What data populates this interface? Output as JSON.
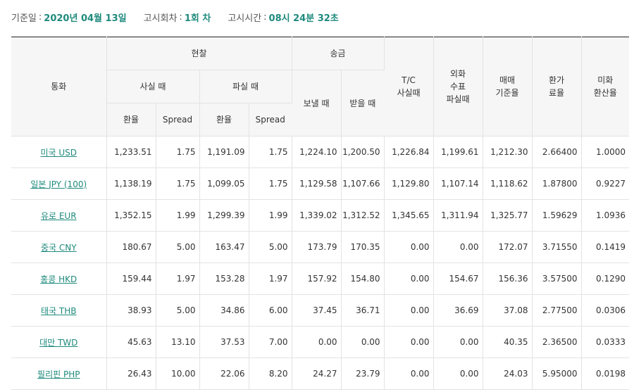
{
  "info": {
    "date_label": "기준일",
    "date_value": "2020년 04월 13일",
    "round_label": "고시회차",
    "round_value": "1회 차",
    "time_label": "고시시간",
    "time_value": "08시 24분 32초"
  },
  "table": {
    "headers": {
      "currency": "통화",
      "cash": "현찰",
      "cash_buy": "사실 때",
      "cash_sell": "파실 때",
      "rate": "환율",
      "spread": "Spread",
      "remit": "송금",
      "remit_send": "보낼 때",
      "remit_receive": "받을 때",
      "tc_buy": [
        "T/C",
        "사실때"
      ],
      "foreign_check_sell": [
        "외화",
        "수표",
        "파실때"
      ],
      "base_rate": [
        "매매",
        "기준율"
      ],
      "conversion_rate": [
        "환가",
        "료율"
      ],
      "usd_conversion": [
        "미화",
        "환산율"
      ]
    },
    "rows": [
      {
        "currency": "미국 USD",
        "cash_buy_rate": "1,233.51",
        "cash_buy_spread": "1.75",
        "cash_sell_rate": "1,191.09",
        "cash_sell_spread": "1.75",
        "send": "1,224.10",
        "receive": "1,200.50",
        "tc_buy": "1,226.84",
        "check_sell": "1,199.61",
        "base_rate": "1,212.30",
        "conversion_rate": "2.66400",
        "usd_conversion": "1.0000"
      },
      {
        "currency": "일본 JPY (100)",
        "cash_buy_rate": "1,138.19",
        "cash_buy_spread": "1.75",
        "cash_sell_rate": "1,099.05",
        "cash_sell_spread": "1.75",
        "send": "1,129.58",
        "receive": "1,107.66",
        "tc_buy": "1,129.80",
        "check_sell": "1,107.14",
        "base_rate": "1,118.62",
        "conversion_rate": "1.87800",
        "usd_conversion": "0.9227"
      },
      {
        "currency": "유로 EUR",
        "cash_buy_rate": "1,352.15",
        "cash_buy_spread": "1.99",
        "cash_sell_rate": "1,299.39",
        "cash_sell_spread": "1.99",
        "send": "1,339.02",
        "receive": "1,312.52",
        "tc_buy": "1,345.65",
        "check_sell": "1,311.94",
        "base_rate": "1,325.77",
        "conversion_rate": "1.59629",
        "usd_conversion": "1.0936"
      },
      {
        "currency": "중국 CNY",
        "cash_buy_rate": "180.67",
        "cash_buy_spread": "5.00",
        "cash_sell_rate": "163.47",
        "cash_sell_spread": "5.00",
        "send": "173.79",
        "receive": "170.35",
        "tc_buy": "0.00",
        "check_sell": "0.00",
        "base_rate": "172.07",
        "conversion_rate": "3.71550",
        "usd_conversion": "0.1419"
      },
      {
        "currency": "홍콩 HKD",
        "cash_buy_rate": "159.44",
        "cash_buy_spread": "1.97",
        "cash_sell_rate": "153.28",
        "cash_sell_spread": "1.97",
        "send": "157.92",
        "receive": "154.80",
        "tc_buy": "0.00",
        "check_sell": "154.67",
        "base_rate": "156.36",
        "conversion_rate": "3.57500",
        "usd_conversion": "0.1290"
      },
      {
        "currency": "태국 THB",
        "cash_buy_rate": "38.93",
        "cash_buy_spread": "5.00",
        "cash_sell_rate": "34.86",
        "cash_sell_spread": "6.00",
        "send": "37.45",
        "receive": "36.71",
        "tc_buy": "0.00",
        "check_sell": "36.69",
        "base_rate": "37.08",
        "conversion_rate": "2.77500",
        "usd_conversion": "0.0306"
      },
      {
        "currency": "대만 TWD",
        "cash_buy_rate": "45.63",
        "cash_buy_spread": "13.10",
        "cash_sell_rate": "37.53",
        "cash_sell_spread": "7.00",
        "send": "0.00",
        "receive": "0.00",
        "tc_buy": "0.00",
        "check_sell": "0.00",
        "base_rate": "40.35",
        "conversion_rate": "2.36500",
        "usd_conversion": "0.0333"
      },
      {
        "currency": "필리핀 PHP",
        "cash_buy_rate": "26.43",
        "cash_buy_spread": "10.00",
        "cash_sell_rate": "22.06",
        "cash_sell_spread": "8.20",
        "send": "24.27",
        "receive": "23.79",
        "tc_buy": "0.00",
        "check_sell": "0.00",
        "base_rate": "24.03",
        "conversion_rate": "5.95000",
        "usd_conversion": "0.0198"
      }
    ]
  }
}
